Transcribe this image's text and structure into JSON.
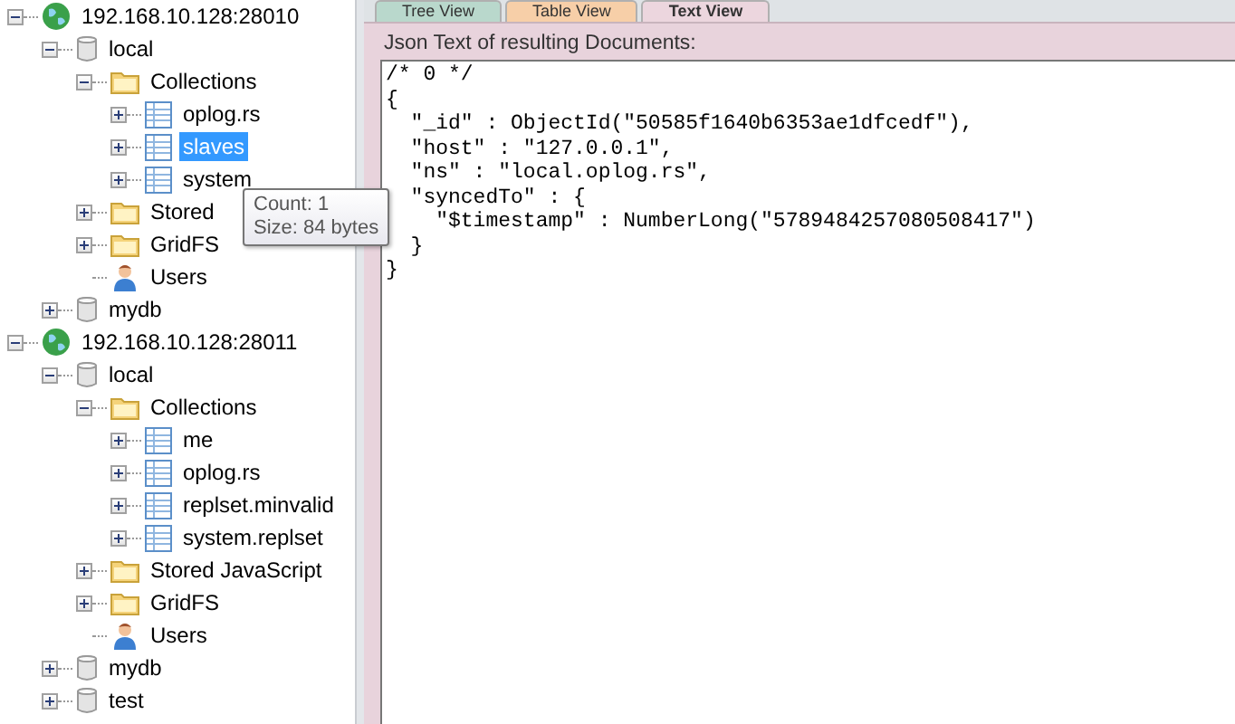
{
  "tree": [
    {
      "kind": "server",
      "label": "192.168.10.128:28010",
      "expanded": true,
      "selected": false,
      "children": [
        {
          "kind": "database",
          "label": "local",
          "expanded": true,
          "selected": false,
          "children": [
            {
              "kind": "folder",
              "label": "Collections",
              "expanded": true,
              "selected": false,
              "children": [
                {
                  "kind": "collection",
                  "label": "oplog.rs",
                  "expanded": false,
                  "selected": false
                },
                {
                  "kind": "collection",
                  "label": "slaves",
                  "expanded": false,
                  "selected": true
                },
                {
                  "kind": "collection",
                  "label": "system",
                  "expanded": false,
                  "selected": false
                }
              ]
            },
            {
              "kind": "folder",
              "label": "Stored",
              "expanded": false,
              "selected": false
            },
            {
              "kind": "folder",
              "label": "GridFS",
              "expanded": false,
              "selected": false
            },
            {
              "kind": "users",
              "label": "Users",
              "selected": false
            }
          ]
        },
        {
          "kind": "database",
          "label": "mydb",
          "expanded": false,
          "selected": false
        }
      ]
    },
    {
      "kind": "server",
      "label": "192.168.10.128:28011",
      "expanded": true,
      "selected": false,
      "children": [
        {
          "kind": "database",
          "label": "local",
          "expanded": true,
          "selected": false,
          "children": [
            {
              "kind": "folder",
              "label": "Collections",
              "expanded": true,
              "selected": false,
              "children": [
                {
                  "kind": "collection",
                  "label": "me",
                  "expanded": false,
                  "selected": false
                },
                {
                  "kind": "collection",
                  "label": "oplog.rs",
                  "expanded": false,
                  "selected": false
                },
                {
                  "kind": "collection",
                  "label": "replset.minvalid",
                  "expanded": false,
                  "selected": false
                },
                {
                  "kind": "collection",
                  "label": "system.replset",
                  "expanded": false,
                  "selected": false
                }
              ]
            },
            {
              "kind": "folder",
              "label": "Stored JavaScript",
              "expanded": false,
              "selected": false
            },
            {
              "kind": "folder",
              "label": "GridFS",
              "expanded": false,
              "selected": false
            },
            {
              "kind": "users",
              "label": "Users",
              "selected": false
            }
          ]
        },
        {
          "kind": "database",
          "label": "mydb",
          "expanded": false,
          "selected": false
        },
        {
          "kind": "database",
          "label": "test",
          "expanded": false,
          "selected": false
        }
      ]
    }
  ],
  "tooltip": {
    "lines": [
      "Count: 1",
      "Size: 84 bytes"
    ]
  },
  "tabs": [
    {
      "label": "Tree View",
      "selected": false,
      "color": "#b9d8cc"
    },
    {
      "label": "Table View",
      "selected": false,
      "color": "#f7cfa8"
    },
    {
      "label": "Text View",
      "selected": true,
      "color": "#ecd6de"
    }
  ],
  "result_label": "Json Text of resulting Documents:",
  "json_lines": [
    "/* 0 */",
    "{",
    "  \"_id\" : ObjectId(\"50585f1640b6353ae1dfcedf\"),",
    "  \"host\" : \"127.0.0.1\",",
    "  \"ns\" : \"local.oplog.rs\",",
    "  \"syncedTo\" : {",
    "    \"$timestamp\" : NumberLong(\"5789484257080508417\")",
    "  }",
    "}"
  ]
}
